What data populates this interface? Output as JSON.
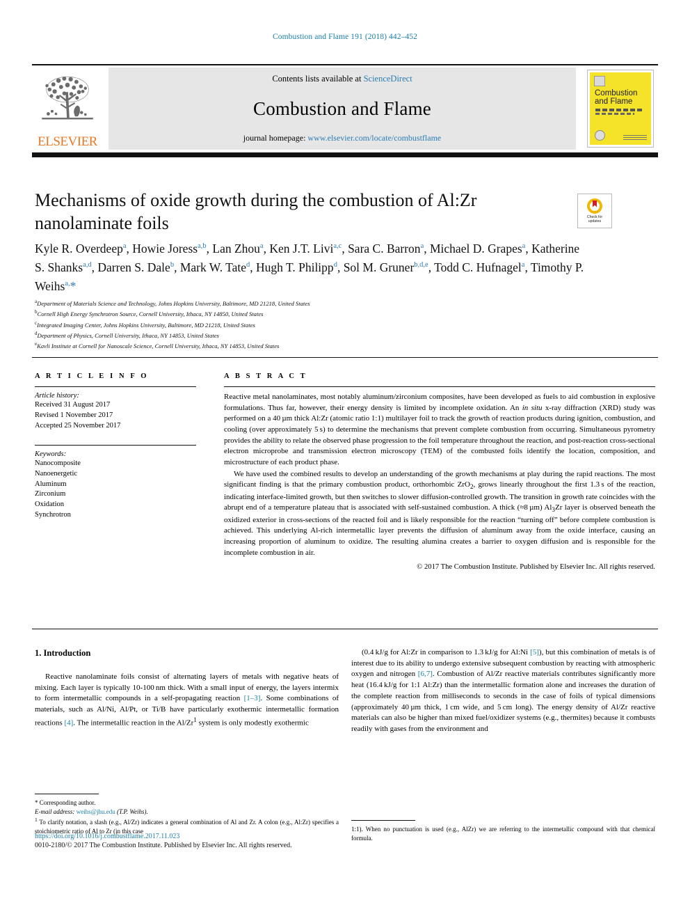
{
  "running_head": "Combustion and Flame 191 (2018) 442–452",
  "masthead": {
    "contents_prefix": "Contents lists available at ",
    "sciencedirect": "ScienceDirect",
    "journal_name": "Combustion and Flame",
    "homepage_prefix": "journal homepage: ",
    "homepage_url": "www.elsevier.com/locate/combustflame",
    "publisher": "ELSEVIER",
    "cover_title_line1": "Combustion",
    "cover_title_line2": "and Flame",
    "accent_link_color": "#2a7cb5",
    "elsevier_orange": "#E87722",
    "cover_yellow": "#f5e32a"
  },
  "crossmark": {
    "line1": "Check for",
    "line2": "updates"
  },
  "article": {
    "title": "Mechanisms of oxide growth during the combustion of Al:Zr nanolaminate foils",
    "authors_html": "Kyle R. Overdeep<sup>a</sup>, Howie Joress<sup>a,b</sup>, Lan Zhou<sup>a</sup>, Ken J.T. Livi<sup>a,c</sup>, Sara C. Barron<sup>a</sup>, Michael D. Grapes<sup>a</sup>, Katherine S. Shanks<sup>a,d</sup>, Darren S. Dale<sup>b</sup>, Mark W. Tate<sup>d</sup>, Hugh T. Philipp<sup>d</sup>, Sol M. Gruner<sup>b,d,e</sup>, Todd C. Hufnagel<sup>a</sup>, Timothy P. Weihs<sup>a,</sup><span class=\"star\">*</span>",
    "affiliations": [
      {
        "mark": "a",
        "text": "Department of Materials Science and Technology, Johns Hopkins University, Baltimore, MD 21218, United States"
      },
      {
        "mark": "b",
        "text": "Cornell High Energy Synchrotron Source, Cornell University, Ithaca, NY 14850, United States"
      },
      {
        "mark": "c",
        "text": "Integrated Imaging Center, Johns Hopkins University, Baltimore, MD 21218, United States"
      },
      {
        "mark": "d",
        "text": "Department of Physics, Cornell University, Ithaca, NY 14853, United States"
      },
      {
        "mark": "e",
        "text": "Kavli Institute at Cornell for Nanoscale Science, Cornell University, Ithaca, NY 14853, United States"
      }
    ]
  },
  "article_info": {
    "heading": "A R T I C L E   I N F O",
    "history_label": "Article history:",
    "history": [
      "Received 31 August 2017",
      "Revised 1 November 2017",
      "Accepted 25 November 2017"
    ],
    "keywords_label": "Keywords:",
    "keywords": [
      "Nanocomposite",
      "Nanoenergetic",
      "Aluminum",
      "Zirconium",
      "Oxidation",
      "Synchrotron"
    ]
  },
  "abstract": {
    "heading": "A B S T R A C T",
    "paragraph1_html": "Reactive metal nanolaminates, most notably aluminum/zirconium composites, have been developed as fuels to aid combustion in explosive formulations. Thus far, however, their energy density is limited by incomplete oxidation. An <i>in situ</i> x-ray diffraction (XRD) study was performed on a 40&#8239;&#181;m thick Al:Zr (atomic ratio 1:1) multilayer foil to track the growth of reaction products during ignition, combustion, and cooling (over approximately 5&#8239;s) to determine the mechanisms that prevent complete combustion from occurring. Simultaneous pyrometry provides the ability to relate the observed phase progression to the foil temperature throughout the reaction, and post-reaction cross-sectional electron microprobe and transmission electron microscopy (TEM) of the combusted foils identify the location, composition, and microstructure of each product phase.",
    "paragraph2_html": "We have used the combined results to develop an understanding of the growth mechanisms at play during the rapid reactions. The most significant finding is that the primary combustion product, orthorhombic ZrO<sub>2</sub>, grows linearly throughout the first 1.3&#8239;s of the reaction, indicating interface-limited growth, but then switches to slower diffusion-controlled growth. The transition in growth rate coincides with the abrupt end of a temperature plateau that is associated with self-sustained combustion. A thick (&#8776;8&#8239;&#181;m) Al<sub>3</sub>Zr layer is observed beneath the oxidized exterior in cross-sections of the reacted foil and is likely responsible for the reaction &#8220;turning off&#8221; before complete combustion is achieved. This underlying Al-rich intermetallic layer prevents the diffusion of aluminum away from the oxide interface, causing an increasing proportion of aluminum to oxidize. The resulting alumina creates a barrier to oxygen diffusion and is responsible for the incomplete combustion in air.",
    "copyright": "© 2017 The Combustion Institute. Published by Elsevier Inc. All rights reserved."
  },
  "body": {
    "section_heading": "1. Introduction",
    "left_paragraph_html": "Reactive nanolaminate foils consist of alternating layers of metals with negative heats of mixing. Each layer is typically 10-100&#8239;nm thick. With a small input of energy, the layers intermix to form intermetallic compounds in a self-propagating reaction <span class=\"cite\">[1&#8211;3]</span>. Some combinations of materials, such as Al/Ni, Al/Pt, or Ti/B have particularly exothermic intermetallic formation reactions <span class=\"cite\">[4]</span>. The intermetallic reaction in the Al/Zr<sup>1</sup> system is only modestly exothermic",
    "right_paragraph_html": "(0.4&#8239;kJ/g for Al:Zr in comparison to 1.3&#8239;kJ/g for Al:Ni <span class=\"cite\">[5]</span>), but this combination of metals is of interest due to its ability to undergo extensive subsequent combustion by reacting with atmospheric oxygen and nitrogen <span class=\"cite\">[6,7]</span>. Combustion of Al/Zr reactive materials contributes significantly more heat (16.4&#8239;kJ/g for 1:1 Al:Zr) than the intermetallic formation alone and increases the duration of the complete reaction from milliseconds to seconds in the case of foils of typical dimensions (approximately 40&#8239;&#181;m thick, 1&#8239;cm wide, and 5&#8239;cm long). The energy density of Al/Zr reactive materials can also be higher than mixed fuel/oxidizer systems (e.g., thermites) because it combusts readily with gases from the environment and"
  },
  "footnotes": {
    "corresponding_marker": "*",
    "corresponding_label": "Corresponding author.",
    "email_label": "E-mail address:",
    "email": "weihs@jhu.edu",
    "email_suffix": "(T.P. Weihs).",
    "note1_html": "<sup>1</sup> To clarify notation, a slash (e.g., Al/Zr) indicates a general combination of Al and Zr. A colon (e.g., Al:Zr) specifies a stoichiometric ratio of Al to Zr (in this case",
    "note1_cont_html": "1:1). When no punctuation is used (e.g., AlZr) we are referring to the intermetallic compound with that chemical formula."
  },
  "footer": {
    "doi": "https://doi.org/10.1016/j.combustflame.2017.11.023",
    "issn_line": "0010-2180/© 2017 The Combustion Institute. Published by Elsevier Inc. All rights reserved."
  }
}
